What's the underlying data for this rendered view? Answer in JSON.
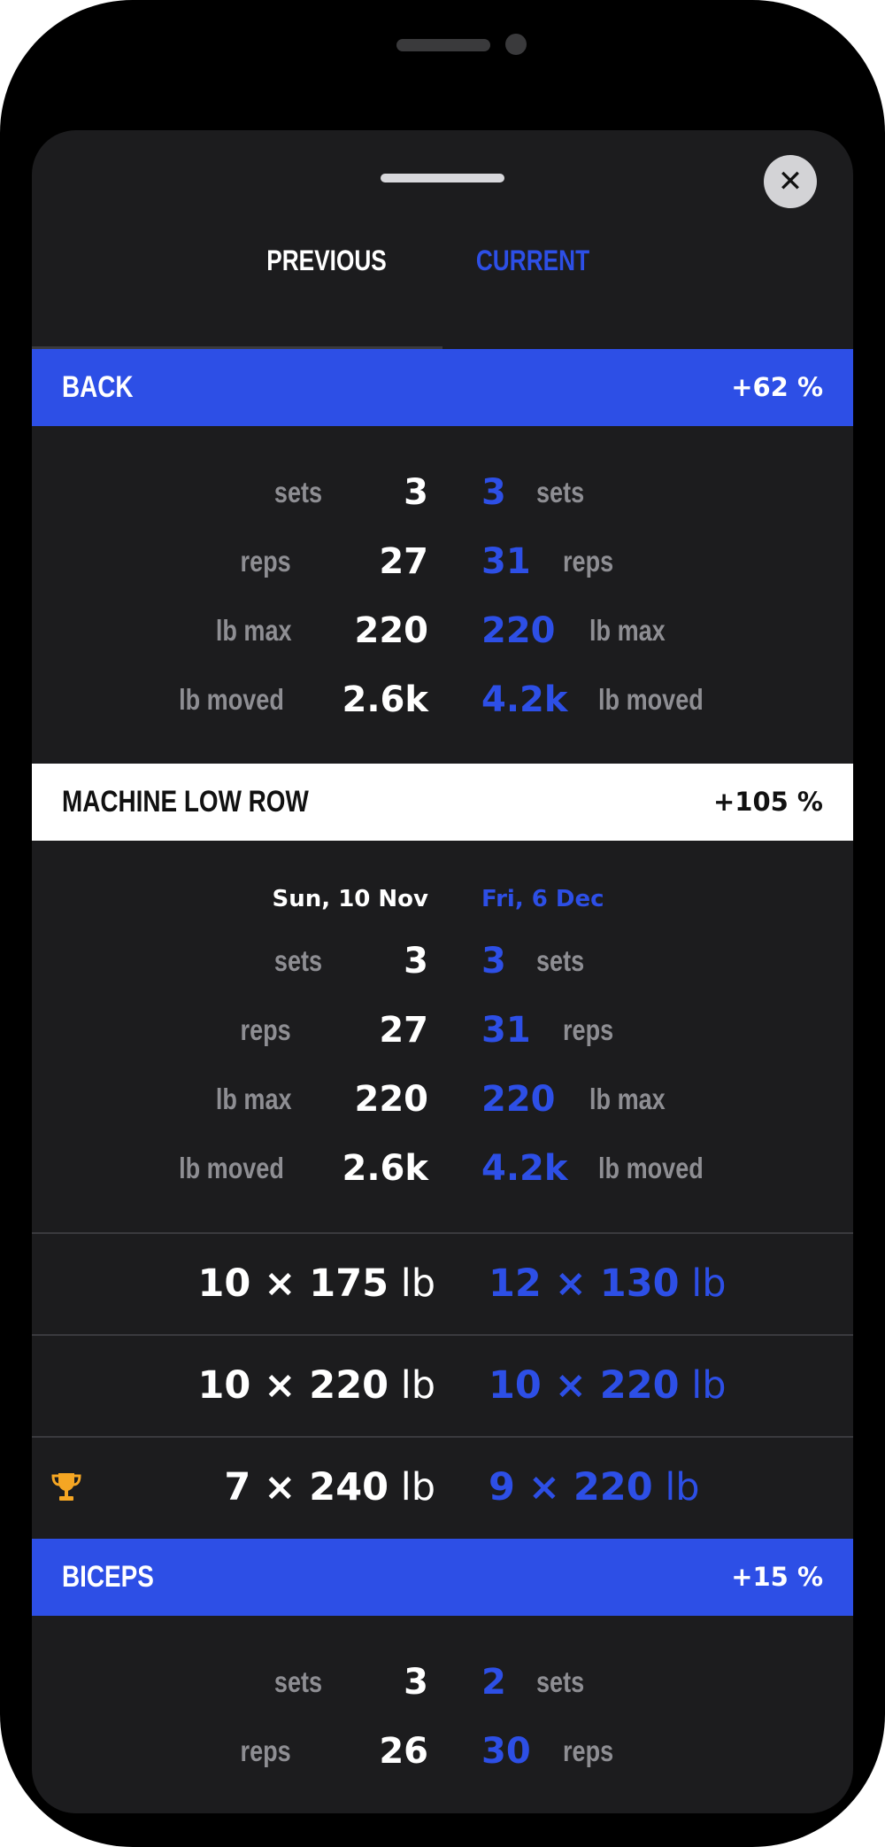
{
  "tabs": {
    "previous": "PREVIOUS",
    "current": "CURRENT"
  },
  "sections": {
    "back": {
      "title": "BACK",
      "pct": "+62 %"
    },
    "machine_low_row": {
      "title": "MACHINE LOW ROW",
      "pct": "+105 %"
    },
    "biceps": {
      "title": "BICEPS",
      "pct": "+15 %"
    }
  },
  "labels": {
    "sets": "sets",
    "reps": "reps",
    "lb_max": "lb max",
    "lb_moved": "lb moved"
  },
  "back_stats": {
    "sets": {
      "prev": "3",
      "curr": "3"
    },
    "reps": {
      "prev": "27",
      "curr": "31"
    },
    "lb_max": {
      "prev": "220",
      "curr": "220"
    },
    "lb_moved": {
      "prev": "2.6k",
      "curr": "4.2k"
    }
  },
  "row_stats": {
    "date": {
      "prev": "Sun, 10 Nov",
      "curr": "Fri, 6 Dec"
    },
    "sets": {
      "prev": "3",
      "curr": "3"
    },
    "reps": {
      "prev": "27",
      "curr": "31"
    },
    "lb_max": {
      "prev": "220",
      "curr": "220"
    },
    "lb_moved": {
      "prev": "2.6k",
      "curr": "4.2k"
    }
  },
  "set_rows": [
    {
      "prev": "10 × 175",
      "curr": "12 × 130",
      "unit": "lb",
      "trophy": false
    },
    {
      "prev": "10 × 220",
      "curr": "10 × 220",
      "unit": "lb",
      "trophy": false
    },
    {
      "prev": "7 × 240",
      "curr": "9 × 220",
      "unit": "lb",
      "trophy": true
    }
  ],
  "biceps_stats": {
    "sets": {
      "prev": "3",
      "curr": "2"
    },
    "reps": {
      "prev": "26",
      "curr": "30"
    }
  },
  "colors": {
    "accent": "#2d4fe6",
    "background": "#1c1c1e",
    "trophy": "#f5a623"
  },
  "icons": {
    "close": "close-icon",
    "trophy": "trophy-icon"
  }
}
